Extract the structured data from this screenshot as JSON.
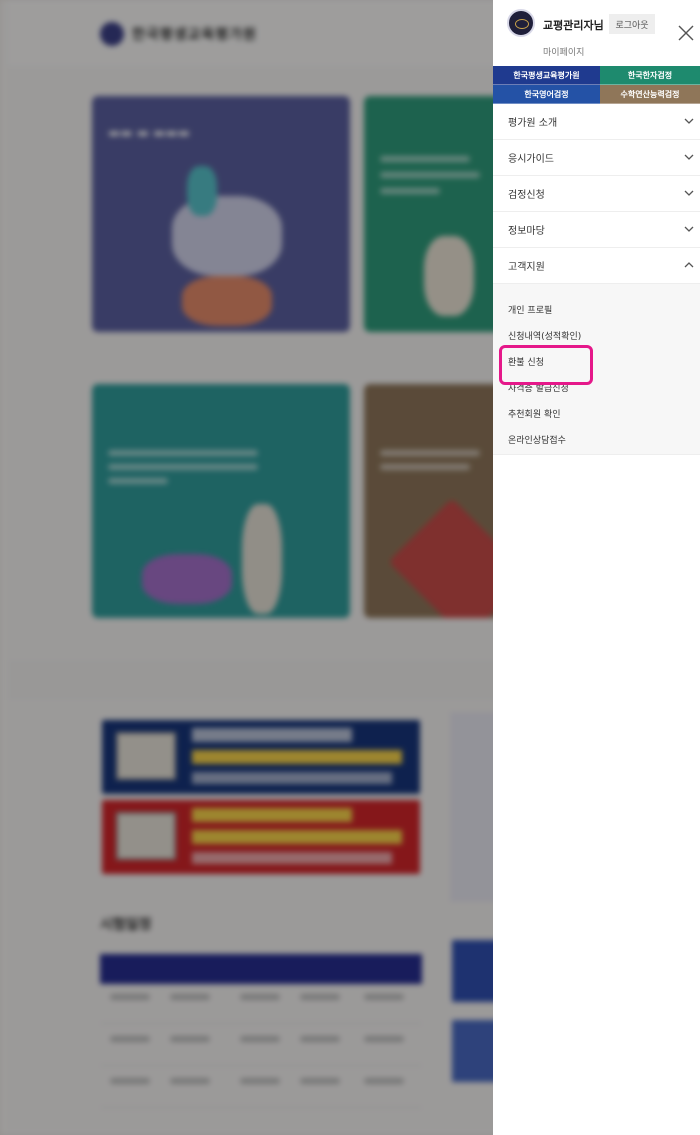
{
  "background_page": {
    "logo_text": "한국평생교육평가원",
    "section_title": "시험일정"
  },
  "panel": {
    "user_name": "교평관리자님",
    "logout_label": "로그아웃",
    "mypage_label": "마이페이지",
    "close_icon": "close-icon",
    "site_tabs": [
      {
        "label": "한국평생교육평가원",
        "color": "#1f3a8f"
      },
      {
        "label": "한국한자검정",
        "color": "#1e8a6e"
      },
      {
        "label": "한국영어검정",
        "color": "#2452a6"
      },
      {
        "label": "수학연산능력검정",
        "color": "#8f7659"
      }
    ],
    "menu": [
      {
        "label": "평가원 소개",
        "icon": "chevron-down-icon"
      },
      {
        "label": "응시가이드",
        "icon": "chevron-down-icon"
      },
      {
        "label": "검정신청",
        "icon": "chevron-down-icon"
      },
      {
        "label": "정보마당",
        "icon": "chevron-down-icon"
      },
      {
        "label": "고객지원",
        "icon": "chevron-up-icon"
      }
    ],
    "submenu": [
      "개인 프로필",
      "신청내역(성적확인)",
      "환불 신청",
      "자격증 발급신청",
      "추천회원 확인",
      "온라인상담접수"
    ],
    "highlight_color": "#e5188a"
  }
}
